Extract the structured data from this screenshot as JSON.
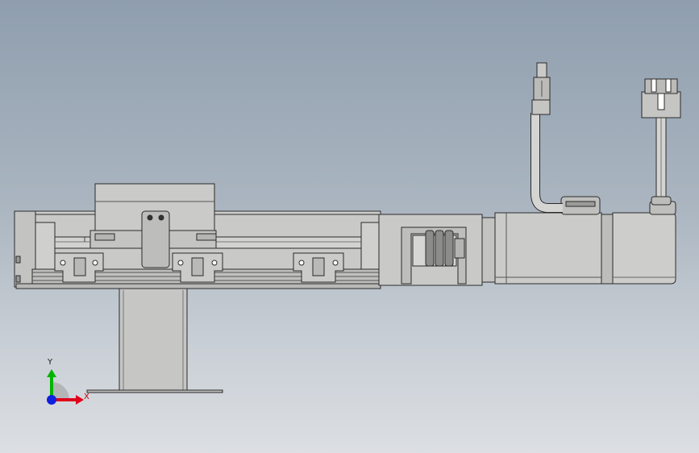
{
  "viewport": {
    "triad": {
      "x_label": "X",
      "y_label": "Y",
      "x_color": "#e0001a",
      "y_color": "#00b400",
      "z_color": "#1020e0"
    }
  },
  "model": {
    "colors": {
      "body": "#c9c9c7",
      "body_dark": "#b3b3b1",
      "edge": "#2b2b2b",
      "cable": "#d4d4d2"
    }
  }
}
